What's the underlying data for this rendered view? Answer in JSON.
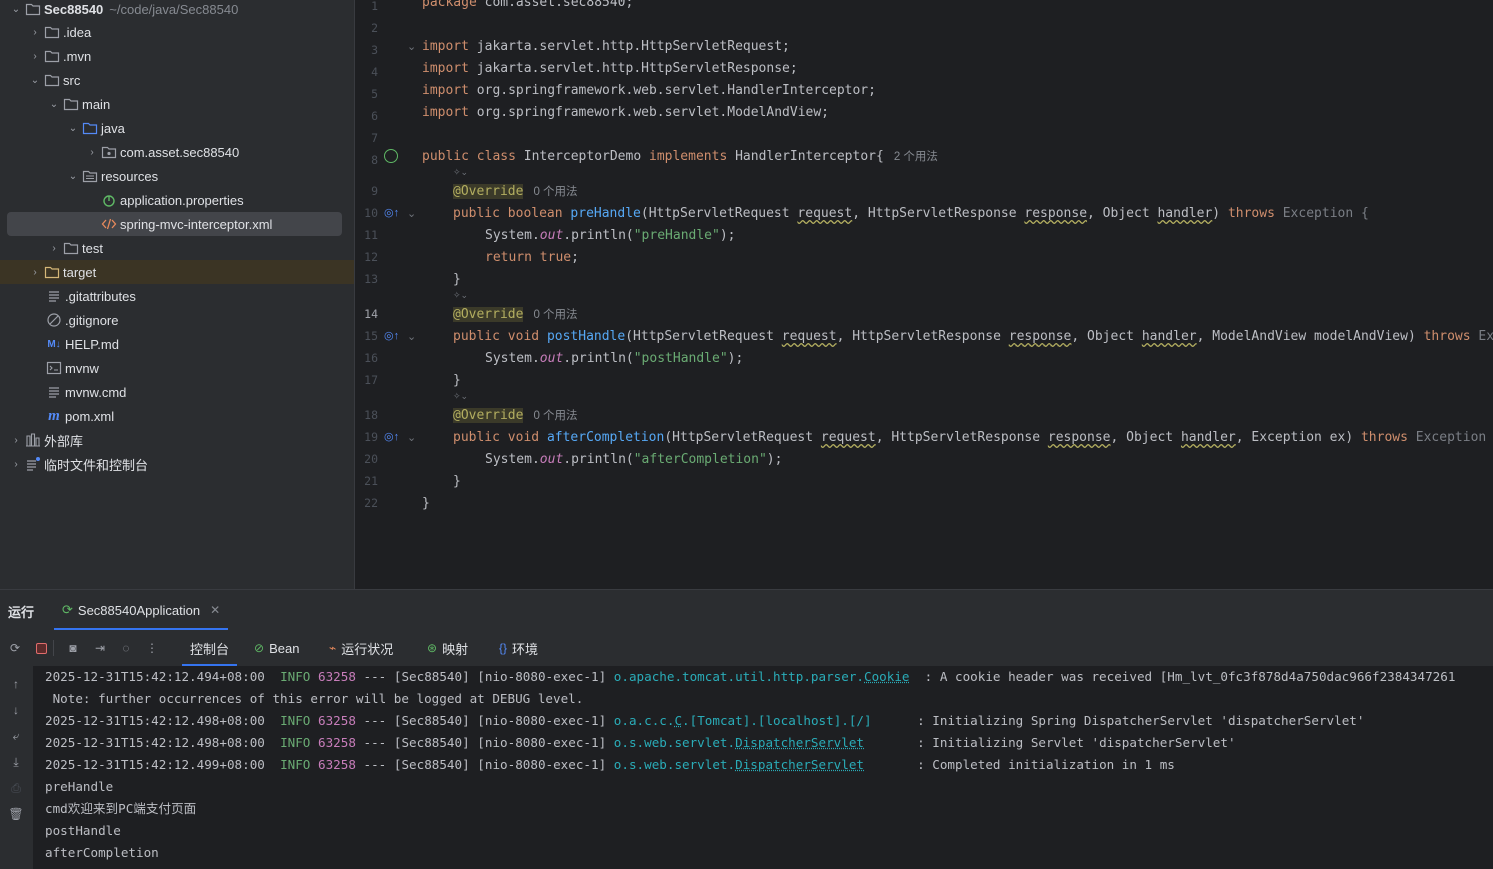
{
  "project": {
    "root_name": "Sec88540",
    "root_path": "~/code/java/Sec88540",
    "nodes": [
      {
        "label": "Sec88540",
        "icon": "folder-icon"
      },
      {
        "label": ".idea",
        "icon": "folder-icon"
      },
      {
        "label": ".mvn",
        "icon": "folder-icon"
      },
      {
        "label": "src",
        "icon": "folder-icon"
      },
      {
        "label": "main",
        "icon": "folder-icon"
      },
      {
        "label": "java",
        "icon": "source-folder-icon"
      },
      {
        "label": "com.asset.sec88540",
        "icon": "package-icon"
      },
      {
        "label": "resources",
        "icon": "resources-folder-icon"
      },
      {
        "label": "application.properties",
        "icon": "spring-properties-icon"
      },
      {
        "label": "spring-mvc-interceptor.xml",
        "icon": "xml-file-icon"
      },
      {
        "label": "test",
        "icon": "folder-icon"
      },
      {
        "label": "target",
        "icon": "folder-icon"
      },
      {
        "label": ".gitattributes",
        "icon": "text-file-icon"
      },
      {
        "label": ".gitignore",
        "icon": "ignore-file-icon"
      },
      {
        "label": "HELP.md",
        "icon": "markdown-icon"
      },
      {
        "label": "mvnw",
        "icon": "shell-script-icon"
      },
      {
        "label": "mvnw.cmd",
        "icon": "shell-script-icon"
      },
      {
        "label": "pom.xml",
        "icon": "maven-icon"
      },
      {
        "label": "外部库",
        "icon": "library-icon"
      },
      {
        "label": "临时文件和控制台",
        "icon": "scratches-icon"
      }
    ]
  },
  "editor": {
    "line_numbers": [
      "1",
      "2",
      "3",
      "4",
      "5",
      "6",
      "7",
      "8",
      "9",
      "10",
      "11",
      "12",
      "13",
      "14",
      "15",
      "16",
      "17",
      "18",
      "19",
      "20",
      "21",
      "22"
    ],
    "current_line": "14",
    "code": {
      "l1_kw": "package",
      "l1_rest": " com.asset.sec88540;",
      "import_kw": "import",
      "l3": " jakarta.servlet.http.HttpServletRequest;",
      "l4": " jakarta.servlet.http.HttpServletResponse;",
      "l5": " org.springframework.web.servlet.HandlerInterceptor;",
      "l6": " org.springframework.web.servlet.ModelAndView;",
      "public": "public",
      "class": "class",
      "class_name": " InterceptorDemo ",
      "implements": "implements",
      "iface": " HandlerInterceptor{",
      "class_usages": "2 个用法",
      "override": "@Override",
      "usages0": "0 个用法",
      "boolean": "boolean",
      "void": "void",
      "return": "return",
      "true": "true",
      "throws": "throws",
      "pre_name": "preHandle",
      "post_name": "postHandle",
      "after_name": "afterCompletion",
      "req_type": "(HttpServletRequest ",
      "req": "request",
      "resp_type": ", HttpServletResponse ",
      "resp": "response",
      "obj_type": ", Object ",
      "handler": "handler",
      "pre_end": ") ",
      "pre_exc": " Exception {",
      "post_mav": ", ModelAndView modelAndView) ",
      "post_exc": " Exc",
      "after_ex": ", Exception ex) ",
      "after_exc": " Exception {",
      "sys": "System.",
      "out": "out",
      "println": ".println(",
      "s_pre": "\"preHandle\"",
      "s_post": "\"postHandle\"",
      "s_after": "\"afterCompletion\"",
      "close_paren": ");",
      "close_brace": "}"
    }
  },
  "run_panel": {
    "title": "运行",
    "tab_label": "Sec88540Application",
    "subtabs": [
      "控制台",
      "Bean",
      "运行状况",
      "映射",
      "环境"
    ],
    "logs": [
      {
        "ts": "2025-12-31T15:42:12.494+08:00",
        "level": "INFO",
        "pid": "63258",
        "sep": "---",
        "app": "[Sec88540]",
        "thread": "[nio-8080-exec-1]",
        "logger_prefix": "o.apache.tomcat.util.http.parser.",
        "logger_link": "Cookie",
        "pad": "  ",
        "msg": ": A cookie header was received [Hm_lvt_0fc3f878d4a750dac966f2384347261"
      },
      {
        "ts": "2025-12-31T15:42:12.498+08:00",
        "level": "INFO",
        "pid": "63258",
        "sep": "---",
        "app": "[Sec88540]",
        "thread": "[nio-8080-exec-1]",
        "logger_prefix": "o.a.c.c.",
        "logger_link": "C",
        "logger_suffix": ".[Tomcat].[localhost].[/]",
        "pad": "      ",
        "msg": ": Initializing Spring DispatcherServlet 'dispatcherServlet'"
      },
      {
        "ts": "2025-12-31T15:42:12.498+08:00",
        "level": "INFO",
        "pid": "63258",
        "sep": "---",
        "app": "[Sec88540]",
        "thread": "[nio-8080-exec-1]",
        "logger_prefix": "o.s.web.servlet.",
        "logger_link": "DispatcherServlet",
        "pad": "       ",
        "msg": ": Initializing Servlet 'dispatcherServlet'"
      },
      {
        "ts": "2025-12-31T15:42:12.499+08:00",
        "level": "INFO",
        "pid": "63258",
        "sep": "---",
        "app": "[Sec88540]",
        "thread": "[nio-8080-exec-1]",
        "logger_prefix": "o.s.web.servlet.",
        "logger_link": "DispatcherServlet",
        "pad": "       ",
        "msg": ": Completed initialization in 1 ms"
      }
    ],
    "note_line": " Note: further occurrences of this error will be logged at DEBUG level.",
    "plain_lines": [
      "preHandle",
      "cmd欢迎来到PC端支付页面",
      "postHandle",
      "afterCompletion"
    ]
  },
  "colors": {
    "accent": "#3574f0",
    "keyword": "#cf8e6d",
    "string": "#6aab73",
    "annotation": "#b3ae60",
    "method": "#56a8f5"
  }
}
